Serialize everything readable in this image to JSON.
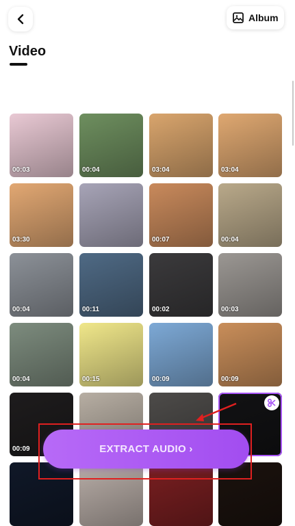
{
  "header": {
    "back_icon": "chevron-left-icon",
    "album_icon": "image-icon",
    "album_label": "Album"
  },
  "section": {
    "title": "Video"
  },
  "videos": [
    {
      "duration": "00:03",
      "bg": "#e9c9d4"
    },
    {
      "duration": "00:04",
      "bg": "#6e8f5f"
    },
    {
      "duration": "03:04",
      "bg": "#d9a56d"
    },
    {
      "duration": "03:04",
      "bg": "#dfa871"
    },
    {
      "duration": "03:30",
      "bg": "#e2a873"
    },
    {
      "duration": "",
      "bg": "#a7a4b7"
    },
    {
      "duration": "00:07",
      "bg": "#c98a5c"
    },
    {
      "duration": "00:04",
      "bg": "#b9a98a"
    },
    {
      "duration": "00:04",
      "bg": "#8c9198"
    },
    {
      "duration": "00:11",
      "bg": "#4f6a85"
    },
    {
      "duration": "00:02",
      "bg": "#3b3a3c"
    },
    {
      "duration": "00:03",
      "bg": "#9b9793"
    },
    {
      "duration": "00:04",
      "bg": "#7d8c7e"
    },
    {
      "duration": "00:15",
      "bg": "#f0e78a"
    },
    {
      "duration": "00:09",
      "bg": "#7da9d6"
    },
    {
      "duration": "00:09",
      "bg": "#c98e5a"
    },
    {
      "duration": "00:09",
      "bg": "#1e1c1d"
    },
    {
      "duration": "",
      "bg": "#b7aea3"
    },
    {
      "duration": "",
      "bg": "#4d4b49"
    },
    {
      "duration": "",
      "bg": "#121214",
      "selected": true
    },
    {
      "duration": "",
      "bg": "#101828"
    },
    {
      "duration": "",
      "bg": "#b9aea8"
    },
    {
      "duration": "",
      "bg": "#7a1f21"
    },
    {
      "duration": "",
      "bg": "#1b120e"
    }
  ],
  "action": {
    "extract_label": "EXTRACT AUDIO ›"
  },
  "colors": {
    "accent": "#a855f7",
    "annotation": "#e02020"
  }
}
